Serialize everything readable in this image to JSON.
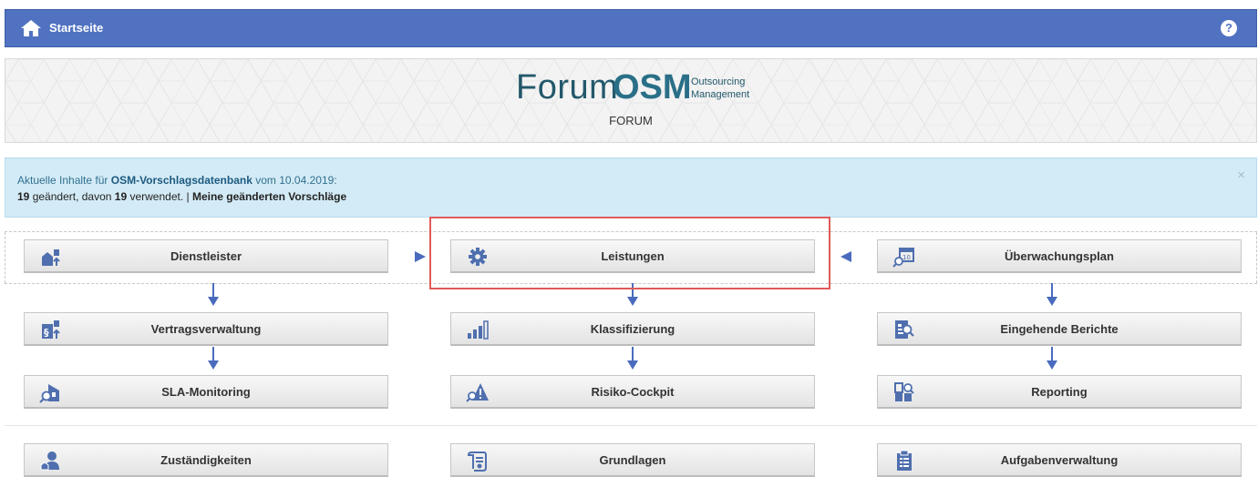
{
  "header": {
    "title": "Startseite",
    "help_label": "?"
  },
  "banner": {
    "logo_forum": "Forum",
    "logo_osm": "OSM",
    "logo_sub_line1": "Outsourcing",
    "logo_sub_line2": "Management",
    "label": "FORUM"
  },
  "alert": {
    "prefix": "Aktuelle Inhalte für ",
    "database": "OSM-Vorschlagsdatenbank",
    "date_text": " vom 10.04.2019:",
    "changed_count": "19",
    "changed_text": " geändert, davon ",
    "used_count": "19",
    "used_text": " verwendet. | ",
    "my_changes_link": "Meine geänderten Vorschläge",
    "close_label": "×"
  },
  "modules": {
    "dienstleister": {
      "label": "Dienstleister",
      "icon": "building-upload-icon"
    },
    "leistungen": {
      "label": "Leistungen",
      "icon": "gear-icon"
    },
    "ueberwachungsplan": {
      "label": "Überwachungsplan",
      "icon": "calendar-search-icon"
    },
    "vertragsverwaltung": {
      "label": "Vertragsverwaltung",
      "icon": "contract-icon"
    },
    "klassifizierung": {
      "label": "Klassifizierung",
      "icon": "bar-chart-icon"
    },
    "eingehende_berichte": {
      "label": "Eingehende Berichte",
      "icon": "report-search-icon"
    },
    "sla_monitoring": {
      "label": "SLA-Monitoring",
      "icon": "sla-search-icon"
    },
    "risiko_cockpit": {
      "label": "Risiko-Cockpit",
      "icon": "warning-search-icon"
    },
    "reporting": {
      "label": "Reporting",
      "icon": "reporting-icon"
    },
    "zustaendigkeiten": {
      "label": "Zuständigkeiten",
      "icon": "person-icon"
    },
    "grundlagen": {
      "label": "Grundlagen",
      "icon": "scroll-icon"
    },
    "aufgabenverwaltung": {
      "label": "Aufgabenverwaltung",
      "icon": "clipboard-icon"
    }
  },
  "colors": {
    "header_bg": "#5072c0",
    "icon_blue": "#4f6fae",
    "arrow_blue": "#4a6bbd",
    "alert_bg": "#d3ebf6",
    "highlight": "#e05a5a"
  }
}
